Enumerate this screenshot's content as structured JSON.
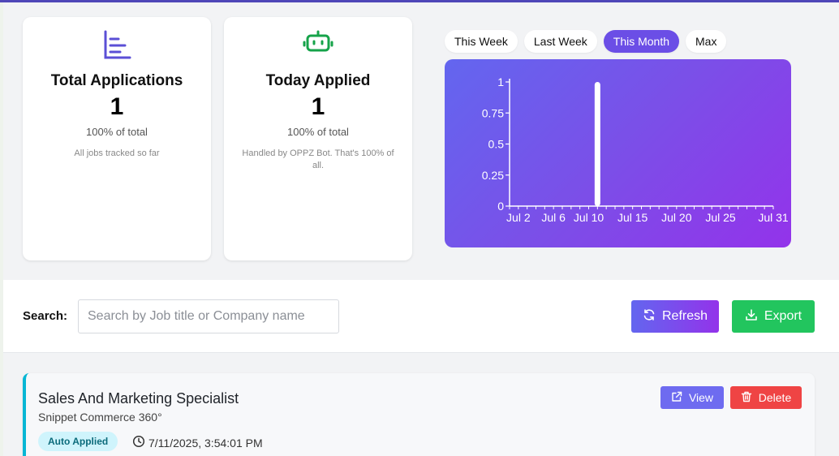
{
  "stats": [
    {
      "title": "Total Applications",
      "value": "1",
      "pct": "100% of total",
      "note": "All jobs tracked so far",
      "icon": "bar-chart-icon",
      "icon_color": "#5b4fd6"
    },
    {
      "title": "Today Applied",
      "value": "1",
      "pct": "100% of total",
      "note": "Handled by OPPZ Bot. That's 100% of all.",
      "icon": "robot-icon",
      "icon_color": "#16a34a"
    }
  ],
  "range_tabs": [
    {
      "label": "This Week",
      "active": false
    },
    {
      "label": "Last Week",
      "active": false
    },
    {
      "label": "This Month",
      "active": true
    },
    {
      "label": "Max",
      "active": false
    }
  ],
  "chart_data": {
    "type": "bar",
    "x_ticks": [
      "Jul 2",
      "Jul 6",
      "Jul 10",
      "Jul 15",
      "Jul 20",
      "Jul 25",
      "Jul 31"
    ],
    "x_range": [
      "Jul 1",
      "Jul 31"
    ],
    "y_ticks": [
      "0",
      "0.25",
      "0.5",
      "0.75",
      "1"
    ],
    "ylim": [
      0,
      1
    ],
    "points": [
      {
        "x": "Jul 11",
        "y": 1
      }
    ],
    "grid": false,
    "bar_color": "#ffffff"
  },
  "toolbar": {
    "search_label": "Search:",
    "search_placeholder": "Search by Job title or Company name",
    "search_value": "",
    "refresh_label": "Refresh",
    "export_label": "Export"
  },
  "jobs": [
    {
      "title": "Sales And Marketing Specialist",
      "company": "Snippet Commerce 360°",
      "badge": "Auto Applied",
      "timestamp": "7/11/2025, 3:54:01 PM",
      "view_label": "View",
      "delete_label": "Delete"
    }
  ],
  "colors": {
    "accent": "#6b4ee6",
    "export": "#22c55e",
    "delete": "#ef4444",
    "card_border": "#06b6d4"
  }
}
